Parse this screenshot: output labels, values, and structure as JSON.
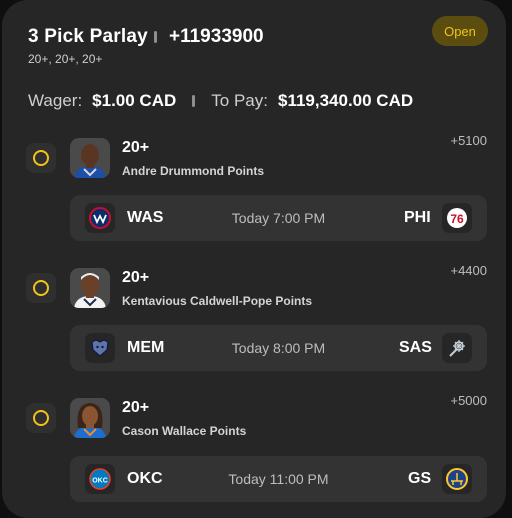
{
  "parlay": {
    "title": "3 Pick Parlay",
    "total_odds": "+11933900",
    "summary": "20+, 20+, 20+",
    "status": "Open"
  },
  "wager": {
    "wager_label": "Wager:",
    "wager_value": "$1.00 CAD",
    "pay_label": "To Pay:",
    "pay_value": "$119,340.00 CAD"
  },
  "picks": [
    {
      "line": "20+",
      "player": "Andre Drummond Points",
      "odds": "+5100",
      "away_team": "WAS",
      "home_team": "PHI",
      "time": "Today 7:00 PM",
      "away_logo": "wizards-logo-icon",
      "home_logo": "76ers-logo-icon"
    },
    {
      "line": "20+",
      "player": "Kentavious Caldwell-Pope Points",
      "odds": "+4400",
      "away_team": "MEM",
      "home_team": "SAS",
      "time": "Today 8:00 PM",
      "away_logo": "grizzlies-logo-icon",
      "home_logo": "spurs-logo-icon"
    },
    {
      "line": "20+",
      "player": "Cason Wallace Points",
      "odds": "+5000",
      "away_team": "OKC",
      "home_team": "GS",
      "time": "Today 11:00 PM",
      "away_logo": "thunder-logo-icon",
      "home_logo": "warriors-logo-icon"
    }
  ],
  "colors": {
    "accent": "#f0c419",
    "card_bg": "#262626",
    "row_bg": "#333333",
    "badge_bg": "#5b4c10"
  }
}
